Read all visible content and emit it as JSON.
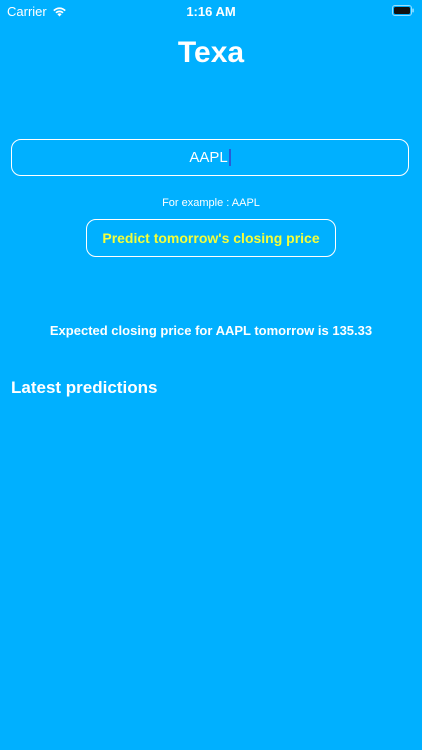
{
  "status_bar": {
    "carrier": "Carrier",
    "time": "1:16 AM"
  },
  "app": {
    "title": "Texa"
  },
  "search": {
    "value": "AAPL",
    "hint": "For example : AAPL"
  },
  "actions": {
    "predict_label": "Predict tomorrow's closing price"
  },
  "result": {
    "message": "Expected closing price for AAPL tomorrow is 135.33"
  },
  "predictions": {
    "title": "Latest predictions"
  },
  "colors": {
    "background": "#00B0FF",
    "button_text": "#F4FF3A",
    "caret": "#2A5BD7"
  }
}
